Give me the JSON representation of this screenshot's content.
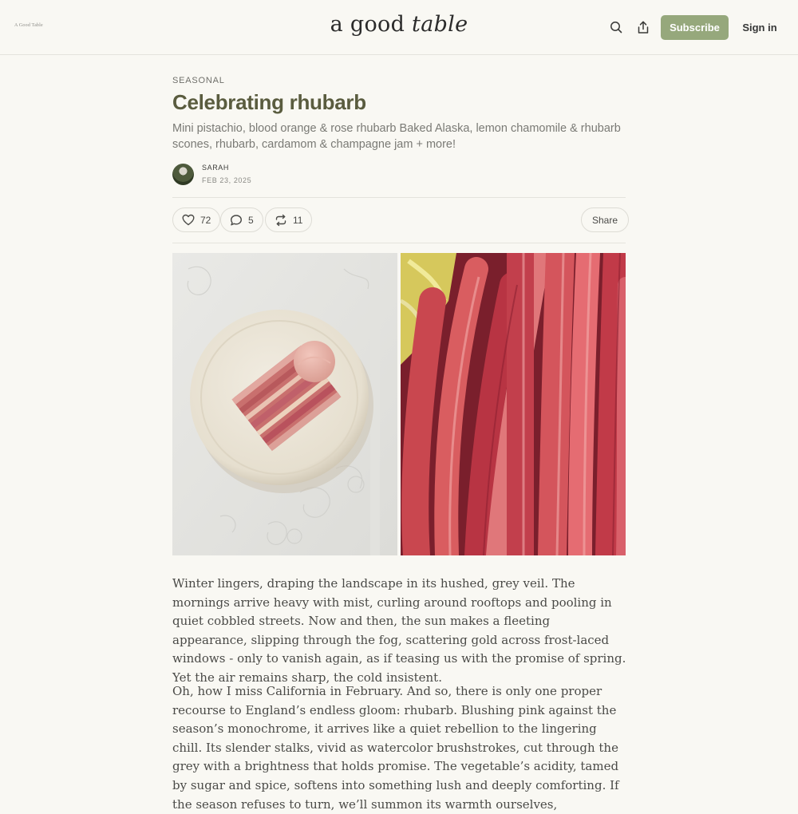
{
  "header": {
    "small_logo": "A Good Table",
    "wordmark_plain": "a good ",
    "wordmark_italic": "table",
    "subscribe_label": "Subscribe",
    "signin_label": "Sign in",
    "icons": [
      "search-icon",
      "share-icon"
    ]
  },
  "post": {
    "section": "SEASONAL",
    "title": "Celebrating rhubarb",
    "subtitle": "Mini pistachio, blood orange & rose rhubarb Baked Alaska, lemon chamomile & rhubarb scones, rhubarb, cardamom & champagne jam + more!",
    "author": "SARAH",
    "date": "FEB 23, 2025"
  },
  "actions": {
    "likes": "72",
    "comments": "5",
    "restacks": "11",
    "share_label": "Share"
  },
  "body": {
    "paragraphs": [
      "Winter lingers, draping the landscape in its hushed, grey veil. The mornings arrive heavy with mist, curling around rooftops and pooling in quiet cobbled streets. Now and then, the sun makes a fleeting appearance, slipping through the fog, scattering gold across frost-laced windows - only to vanish again, as if teasing us with the promise of spring. Yet the air remains sharp, the cold insistent.",
      "Oh, how I miss California in February. And so, there is only one proper recourse to England’s endless gloom: rhubarb. Blushing pink against the season’s monochrome, it arrives like a quiet rebellion to the lingering chill. Its slender stalks, vivid as watercolor brushstrokes, cut through the grey with a brightness that holds promise. The vegetable’s acidity, tamed by sugar and spice, softens into something lush and deeply comforting. If the season refuses to turn, we’ll summon its warmth ourselves,"
    ]
  },
  "colors": {
    "background": "#f9f8f3",
    "accent": "#96a87c",
    "title": "#5a5c3f"
  }
}
